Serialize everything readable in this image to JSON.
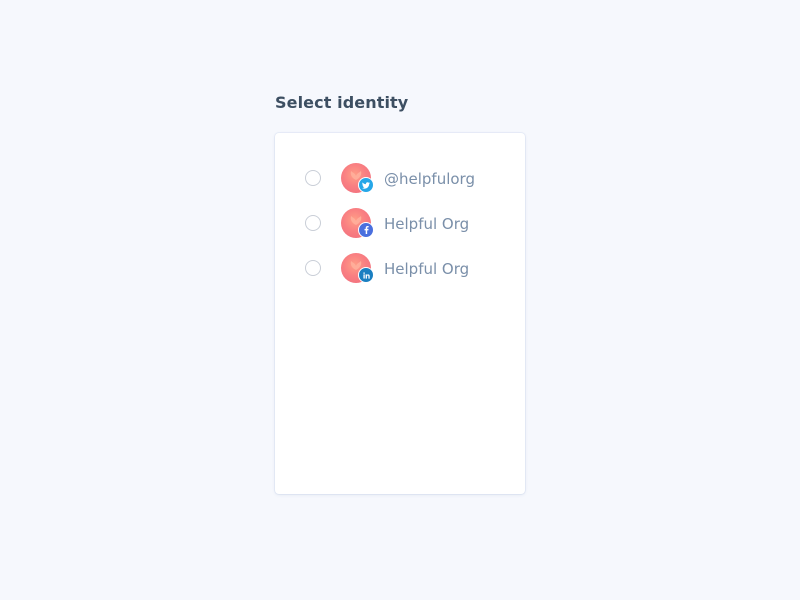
{
  "heading": "Select identity",
  "identities": [
    {
      "name": "@helpfulorg",
      "network": "twitter",
      "badge_icon": "twitter-icon",
      "badge_color": "#26a7e8",
      "selected": false
    },
    {
      "name": "Helpful Org",
      "network": "facebook",
      "badge_icon": "facebook-icon",
      "badge_color": "#4a6fde",
      "selected": false
    },
    {
      "name": "Helpful Org",
      "network": "linkedin",
      "badge_icon": "linkedin-icon",
      "badge_color": "#1a7fc1",
      "selected": false
    }
  ],
  "colors": {
    "background": "#f6f8fd",
    "card": "#ffffff",
    "heading": "#3d4f62",
    "identity_text": "#7a8fa9",
    "avatar": "#f97f82"
  }
}
